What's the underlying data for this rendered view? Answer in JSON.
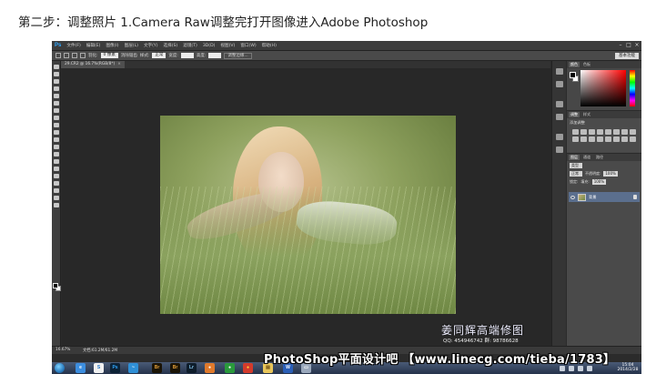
{
  "caption": "第二步：调整照片 1.Camera Raw调整完打开图像进入Adobe Photoshop",
  "app": {
    "logo": "Ps",
    "menu": [
      "文件(F)",
      "编辑(E)",
      "图像(I)",
      "图层(L)",
      "文字(Y)",
      "选择(S)",
      "滤镜(T)",
      "3D(D)",
      "视图(V)",
      "窗口(W)",
      "帮助(H)"
    ],
    "window_controls": [
      "–",
      "□",
      "×"
    ]
  },
  "options": {
    "feather_label": "羽化:",
    "feather_value": "0 像素",
    "antialias_label": "消除锯齿",
    "style_label": "样式:",
    "style_value": "正常",
    "width_label": "宽度:",
    "height_label": "高度:",
    "refine_button": "调整边缘...",
    "workspace": "基本功能"
  },
  "document": {
    "tab_title": "29.CR2 @ 16.7%(RGB/8*)",
    "close": "×",
    "zoom": "16.67%",
    "info": "文档:61.2M/61.2M"
  },
  "panels": {
    "color_tabs": [
      "颜色",
      "色板"
    ],
    "adjust_tabs": [
      "调整",
      "样式"
    ],
    "adjust_title": "添加调整",
    "layers_tabs": [
      "图层",
      "通道",
      "路径"
    ],
    "kind_label": "类型",
    "blend_mode": "正常",
    "opacity_label": "不透明度:",
    "opacity_value": "100%",
    "lock_label": "锁定:",
    "fill_label": "填充:",
    "fill_value": "100%",
    "layer_name": "背景"
  },
  "watermark": {
    "logo": "姜同辉高端修图",
    "qq": "QQ: 454946742   群: 98786628"
  },
  "banner": "PhotoShop平面设计吧 【www.linecg.com/tieba/1783】",
  "taskbar": {
    "icons": [
      {
        "label": "e",
        "color": "#3c8ee0",
        "text_color": "#ffffff"
      },
      {
        "label": "S",
        "color": "#f0f0f0",
        "text_color": "#1a6fc4"
      },
      {
        "label": "Ps",
        "color": "#0c2236",
        "text_color": "#31a8ff"
      },
      {
        "label": "~",
        "color": "#2f8fd6",
        "text_color": "#ffffff"
      },
      {
        "label": "Br",
        "color": "#1b1406",
        "text_color": "#e8a33c"
      },
      {
        "label": "Br",
        "color": "#1b1406",
        "text_color": "#e8a33c"
      },
      {
        "label": "Lr",
        "color": "#0e1d2b",
        "text_color": "#86c7ef"
      },
      {
        "label": "●",
        "color": "#e07a2c",
        "text_color": "#ffffff"
      },
      {
        "label": "●",
        "color": "#2a9a3c",
        "text_color": "#ffffff"
      },
      {
        "label": "●",
        "color": "#d43b2c",
        "text_color": "#ffd43b"
      },
      {
        "label": "▤",
        "color": "#e8c55a",
        "text_color": "#6a4a10"
      },
      {
        "label": "W",
        "color": "#2b5fb7",
        "text_color": "#ffffff"
      },
      {
        "label": "▭",
        "color": "#9aa8bc",
        "text_color": "#ffffff"
      }
    ],
    "clock_time": "15:04",
    "clock_date": "2014/2/28"
  }
}
